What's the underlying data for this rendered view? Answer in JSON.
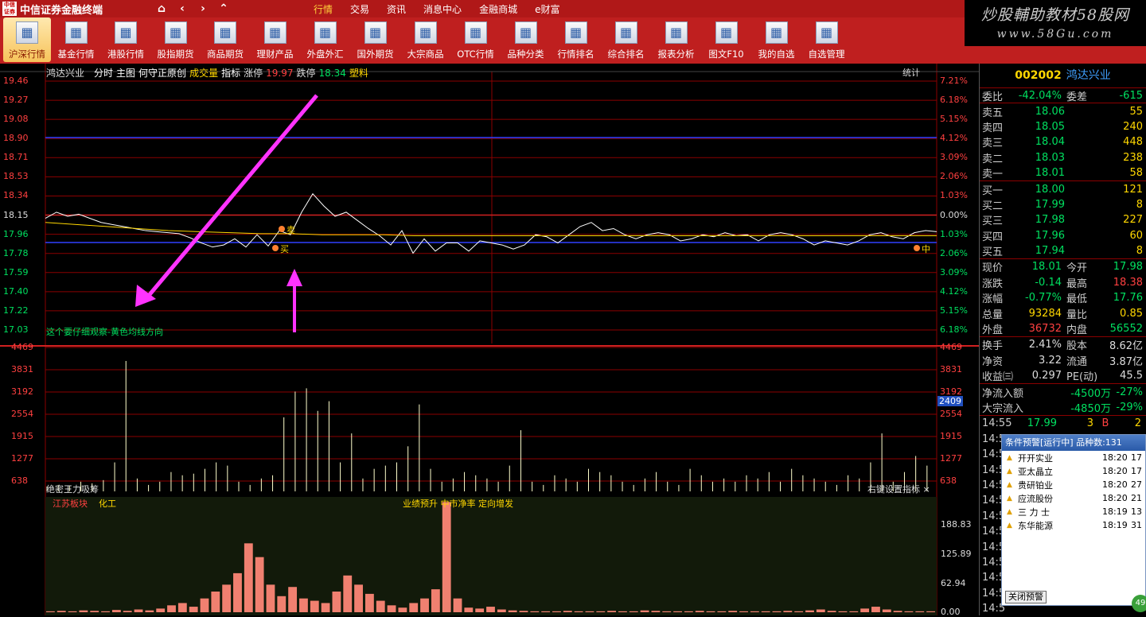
{
  "app": {
    "logo": "中信证券",
    "title": "中信证券金融终端",
    "nav": [
      "⌂",
      "‹",
      "›",
      "⌃"
    ],
    "menu": [
      {
        "label": "行情",
        "active": true
      },
      {
        "label": "交易"
      },
      {
        "label": "资讯"
      },
      {
        "label": "消息中心"
      },
      {
        "label": "金融商城"
      },
      {
        "label": "e财富"
      }
    ]
  },
  "watermark": {
    "line1": "炒股輔助教材58股网",
    "line2": "www.58Gu.com"
  },
  "toolbar": [
    {
      "label": "沪深行情",
      "icon": "market-chart-icon",
      "active": true
    },
    {
      "label": "基金行情",
      "icon": "fund-chart-icon"
    },
    {
      "label": "港股行情",
      "icon": "hk-flower-icon"
    },
    {
      "label": "股指期货",
      "icon": "magnifier-chart-icon"
    },
    {
      "label": "商品期货",
      "icon": "commodity-bars-icon"
    },
    {
      "label": "理财产品",
      "icon": "dollar-icon"
    },
    {
      "label": "外盘外汇",
      "icon": "globe-icon"
    },
    {
      "label": "国外期货",
      "icon": "world-chart-icon"
    },
    {
      "label": "大宗商品",
      "icon": "bulk-bars-icon"
    },
    {
      "label": "OTC行情",
      "icon": "otc-table-icon"
    },
    {
      "label": "品种分类",
      "icon": "category-icon"
    },
    {
      "label": "行情排名",
      "icon": "ranking-icon"
    },
    {
      "label": "综合排名",
      "icon": "overall-rank-icon"
    },
    {
      "label": "报表分析",
      "icon": "report-icon"
    },
    {
      "label": "图文F10",
      "icon": "f10-doc-icon"
    },
    {
      "label": "我的自选",
      "icon": "star-folder-icon"
    },
    {
      "label": "自选管理",
      "icon": "manage-icon"
    }
  ],
  "chart": {
    "stock": "鸿达兴业",
    "mode": "分时",
    "items": [
      "主图",
      "何守正原创",
      "成交量",
      "指标"
    ],
    "limit_up_label": "涨停",
    "limit_up": "19.97",
    "limit_down_label": "跌停",
    "limit_down": "18.34",
    "sector": "塑料",
    "stats_button": "统计",
    "price_ticks": [
      "19.46",
      "19.27",
      "19.08",
      "18.90",
      "18.71",
      "18.53",
      "18.34",
      "18.15",
      "17.96",
      "17.78",
      "17.59",
      "17.40",
      "17.22",
      "17.03"
    ],
    "pct_ticks": [
      "7.21%",
      "6.18%",
      "5.15%",
      "4.12%",
      "3.09%",
      "2.06%",
      "1.03%",
      "0.00%",
      "1.03%",
      "2.06%",
      "3.09%",
      "4.12%",
      "5.15%",
      "6.18%"
    ],
    "vol_ticks": [
      "4469",
      "3831",
      "3192",
      "2554",
      "1915",
      "1277",
      "638"
    ],
    "vol_cursor": "2409",
    "annotation": "这个要仔细观察-黄色均线方向",
    "marker_labels": {
      "sell": "卖",
      "buy": "买",
      "mid": "中"
    }
  },
  "chart_data": {
    "type": "line",
    "x_label": "",
    "ylabel": "",
    "ylim": [
      17.03,
      19.46
    ],
    "prev_close": 18.15,
    "price": [
      18.12,
      18.18,
      18.14,
      18.16,
      18.12,
      18.08,
      18.06,
      18.04,
      18.02,
      18.0,
      17.99,
      17.98,
      17.97,
      17.93,
      17.88,
      17.84,
      17.86,
      17.92,
      17.84,
      17.96,
      17.85,
      18.0,
      17.96,
      18.18,
      18.36,
      18.24,
      18.14,
      18.18,
      18.1,
      18.02,
      17.95,
      17.86,
      18.0,
      17.78,
      17.92,
      17.8,
      17.88,
      17.88,
      17.8,
      17.9,
      17.88,
      17.86,
      17.82,
      17.86,
      17.96,
      17.94,
      17.88,
      17.96,
      18.04,
      18.08,
      18.0,
      18.02,
      17.96,
      17.92,
      17.96,
      17.98,
      17.96,
      17.9,
      17.92,
      17.96,
      17.94,
      17.98,
      17.95,
      17.96,
      17.9,
      17.96,
      17.98,
      17.96,
      17.92,
      17.86,
      17.9,
      17.88,
      17.86,
      17.9,
      17.96,
      17.98,
      17.94,
      17.92,
      17.98,
      18.0,
      17.99
    ],
    "avg": [
      18.08,
      18.06,
      18.04,
      18.02,
      18.0,
      17.99,
      17.98,
      17.97,
      17.97,
      17.96,
      17.96,
      17.96,
      17.95,
      17.95,
      17.95,
      17.95,
      17.95,
      17.95,
      17.95,
      17.95,
      17.95,
      17.95,
      17.95,
      17.95,
      17.95,
      17.95,
      17.95,
      17.95,
      17.95,
      17.95
    ],
    "volume_ylim": [
      0,
      4469
    ],
    "volume": [
      150,
      200,
      180,
      300,
      250,
      350,
      900,
      4050,
      400,
      200,
      300,
      600,
      500,
      550,
      700,
      900,
      800,
      300,
      200,
      400,
      500,
      2300,
      3100,
      3200,
      2500,
      2800,
      900,
      1800,
      400,
      700,
      800,
      900,
      1400,
      2700,
      700,
      300,
      400,
      600,
      500,
      400,
      300,
      800,
      1900,
      300,
      200,
      500,
      400,
      300,
      700,
      600,
      500,
      300,
      200,
      400,
      600,
      300,
      200,
      700,
      500,
      300,
      400,
      300,
      500,
      400,
      600,
      300,
      700,
      500,
      400,
      300,
      200,
      500,
      400,
      900,
      1800,
      300,
      600,
      1100,
      800
    ]
  },
  "indicator": {
    "title": "绝密王力吸筹",
    "right_label": "右键设置指标",
    "close": "×",
    "sector_a": "江苏板块",
    "sector_b": "化工",
    "notes": "业绩预升  中市净率  定向增发",
    "ticks": [
      "188.83",
      "125.89",
      "62.94",
      "0.00"
    ],
    "ylim": [
      0,
      251
    ],
    "bars": [
      2,
      3,
      2,
      4,
      3,
      2,
      5,
      3,
      6,
      4,
      8,
      15,
      20,
      12,
      30,
      45,
      60,
      85,
      150,
      120,
      60,
      35,
      55,
      30,
      25,
      20,
      45,
      80,
      60,
      40,
      25,
      15,
      10,
      20,
      30,
      50,
      240,
      30,
      10,
      8,
      12,
      6,
      4,
      3,
      2,
      2,
      2,
      3,
      2,
      2,
      2,
      3,
      2,
      2,
      4,
      3,
      2,
      2,
      2,
      3,
      2,
      2,
      3,
      2,
      2,
      2,
      2,
      3,
      2,
      4,
      6,
      3,
      2,
      2,
      8,
      12,
      6,
      3,
      2,
      2,
      2
    ]
  },
  "quote": {
    "code": "002002",
    "name": "鸿达兴业",
    "webi_label": "委比",
    "webi": "-42.04%",
    "weicha_label": "委差",
    "weicha": "-615",
    "asks": [
      {
        "label": "卖五",
        "price": "18.06",
        "vol": "55"
      },
      {
        "label": "卖四",
        "price": "18.05",
        "vol": "240"
      },
      {
        "label": "卖三",
        "price": "18.04",
        "vol": "448"
      },
      {
        "label": "卖二",
        "price": "18.03",
        "vol": "238"
      },
      {
        "label": "卖一",
        "price": "18.01",
        "vol": "58"
      }
    ],
    "bids": [
      {
        "label": "买一",
        "price": "18.00",
        "vol": "121"
      },
      {
        "label": "买二",
        "price": "17.99",
        "vol": "8"
      },
      {
        "label": "买三",
        "price": "17.98",
        "vol": "227"
      },
      {
        "label": "买四",
        "price": "17.96",
        "vol": "60"
      },
      {
        "label": "买五",
        "price": "17.94",
        "vol": "8"
      }
    ],
    "stats": [
      [
        "现价",
        "18.01",
        "今开",
        "17.98"
      ],
      [
        "涨跌",
        "-0.14",
        "最高",
        "18.38"
      ],
      [
        "涨幅",
        "-0.77%",
        "最低",
        "17.76"
      ],
      [
        "总量",
        "93284",
        "量比",
        "0.85"
      ],
      [
        "外盘",
        "36732",
        "内盘",
        "56552"
      ]
    ],
    "stats2": [
      [
        "换手",
        "2.41%",
        "股本",
        "8.62亿"
      ],
      [
        "净资",
        "3.22",
        "流通",
        "3.87亿"
      ],
      [
        "收益㈢",
        "0.297",
        "PE(动)",
        "45.5"
      ]
    ],
    "flows": [
      [
        "净流入额",
        "-4500万",
        "-27%"
      ],
      [
        "大宗流入",
        "-4850万",
        "-29%"
      ]
    ],
    "tick": {
      "time": "14:55",
      "price": "17.99",
      "vol": "3",
      "dir": "B",
      "n": "2"
    },
    "tick_time": "14:5"
  },
  "alert": {
    "title": "条件预警[运行中] 品种数:131",
    "rows": [
      {
        "name": "开开实业",
        "time": "18:20",
        "n": "17"
      },
      {
        "name": "亚太晶立",
        "time": "18:20",
        "n": "17"
      },
      {
        "name": "贵研铂业",
        "time": "18:20",
        "n": "27"
      },
      {
        "name": "应流股份",
        "time": "18:20",
        "n": "21"
      },
      {
        "name": "三 力 士",
        "time": "18:19",
        "n": "13"
      },
      {
        "name": "东华能源",
        "time": "18:19",
        "n": "31"
      }
    ],
    "close_btn": "关闭预警",
    "badge": "49"
  },
  "colors": {
    "up": "#ff4040",
    "down": "#00e060",
    "grid": "#8b0000",
    "avg": "#ffd700",
    "price": "#ffffff",
    "arrow": "#ff33ff"
  }
}
